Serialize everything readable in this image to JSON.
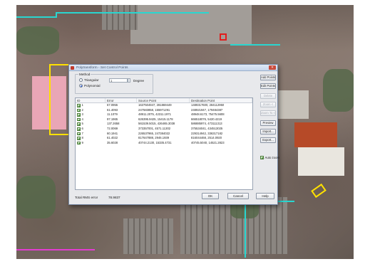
{
  "dialog": {
    "title": "Polytransform - Set Control Points",
    "close_glyph": "✕",
    "method": {
      "group_label": "Method",
      "options": [
        {
          "label": "Triangular",
          "selected": false
        },
        {
          "label": "Polynomial",
          "selected": true
        }
      ],
      "degree_value": "1",
      "degree_label": "Degree"
    },
    "table": {
      "headers": [
        "ID",
        "Error",
        "Source Point",
        "Destination Point"
      ],
      "rows": [
        {
          "id": "1",
          "error": "67.0955",
          "source": "1637504947, 281869449",
          "destination": "1489317600, 284112950"
        },
        {
          "id": "2",
          "error": "61.4093",
          "source": "247583858, 155971291",
          "destination": "248921947, 179484387"
        },
        {
          "id": "3",
          "error": "11.1079",
          "source": "48911.2075, 42311.1971",
          "destination": "48948.6173, 75475.5608"
        },
        {
          "id": "4",
          "error": "97.1965",
          "source": "626395.9425, 15415.1178",
          "destination": "666518076, 5420.4219"
        },
        {
          "id": "5",
          "error": "137.2658",
          "source": "561539.5015, 426465.3038",
          "destination": "586885974, 473111313"
        },
        {
          "id": "6",
          "error": "72.0069",
          "source": "373357001, 4571.11302",
          "destination": "375534041, 434513025"
        },
        {
          "id": "7",
          "error": "60.1941",
          "source": "226537965, 247384022",
          "destination": "229314942, 336317182"
        },
        {
          "id": "8",
          "error": "61.4022",
          "source": "817647888, 2946.1939",
          "destination": "816044468, 2514.0920"
        },
        {
          "id": "9",
          "error": "35.6028",
          "source": "40744.2130, 15335.4731",
          "destination": "40745.5040, 14521.2823"
        }
      ]
    },
    "side_buttons": [
      {
        "label": "Add Points <",
        "disabled": false
      },
      {
        "label": "Edit Points <",
        "disabled": false
      },
      {
        "label": "Delete",
        "disabled": true
      },
      {
        "label": "Zoom <",
        "disabled": true
      },
      {
        "label": "Zoom To <",
        "disabled": true
      },
      {
        "label": "Preview",
        "disabled": false
      },
      {
        "label": "Import...",
        "disabled": false
      },
      {
        "label": "Export...",
        "disabled": false
      }
    ],
    "auto_zoom_label": "Auto zoom",
    "total_label": "Total RMS error",
    "total_value": "78.9837",
    "ok_label": "OK",
    "cancel_label": "Cancel",
    "help_label": "Help"
  }
}
